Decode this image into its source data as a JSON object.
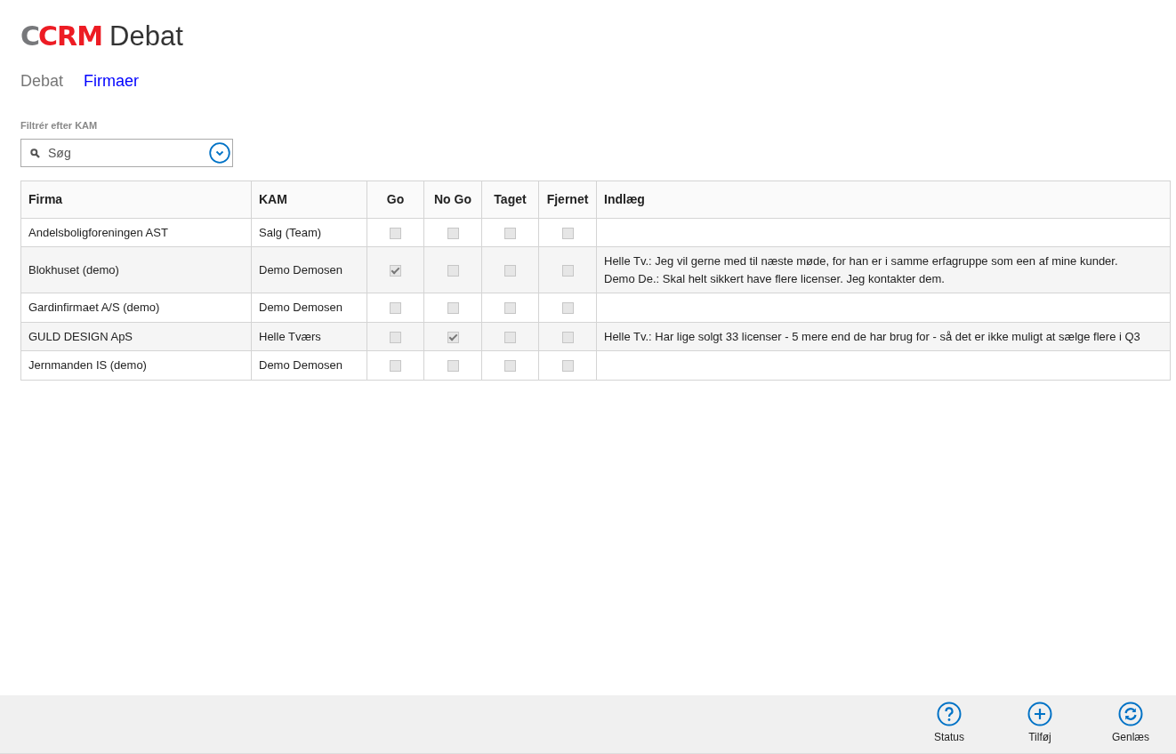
{
  "logo": {
    "part_1": "C",
    "part_2": "CRM",
    "app_name": "Debat"
  },
  "tabs": [
    {
      "label": "Debat",
      "selected": false
    },
    {
      "label": "Firmaer",
      "selected": true
    }
  ],
  "filter": {
    "label": "Filtrér efter KAM",
    "placeholder": "Søg"
  },
  "table": {
    "columns": [
      "Firma",
      "KAM",
      "Go",
      "No Go",
      "Taget",
      "Fjernet",
      "Indlæg"
    ],
    "rows": [
      {
        "firma": "Andelsboligforeningen AST",
        "kam": "Salg (Team)",
        "go": false,
        "no_go": false,
        "taget": false,
        "fjernet": false,
        "indlaeg": []
      },
      {
        "firma": "Blokhuset (demo)",
        "kam": "Demo Demosen",
        "go": true,
        "no_go": false,
        "taget": false,
        "fjernet": false,
        "indlaeg": [
          "Helle Tv.: Jeg vil gerne med til næste møde, for han er i samme erfagruppe som een af mine kunder.",
          "Demo De.: Skal helt sikkert have flere licenser. Jeg kontakter dem."
        ]
      },
      {
        "firma": "Gardinfirmaet A/S (demo)",
        "kam": "Demo Demosen",
        "go": false,
        "no_go": false,
        "taget": false,
        "fjernet": false,
        "indlaeg": []
      },
      {
        "firma": "GULD DESIGN ApS",
        "kam": "Helle Tværs",
        "go": false,
        "no_go": true,
        "taget": false,
        "fjernet": false,
        "indlaeg": [
          "Helle Tv.: Har lige solgt 33 licenser - 5 mere end de har brug for - så det er ikke muligt at sælge flere i Q3"
        ]
      },
      {
        "firma": "Jernmanden IS (demo)",
        "kam": "Demo Demosen",
        "go": false,
        "no_go": false,
        "taget": false,
        "fjernet": false,
        "indlaeg": []
      }
    ]
  },
  "command_bar": [
    {
      "kind": "help",
      "label": "Status"
    },
    {
      "kind": "add",
      "label": "Tilføj"
    },
    {
      "kind": "refresh",
      "label": "Genlæs"
    }
  ]
}
